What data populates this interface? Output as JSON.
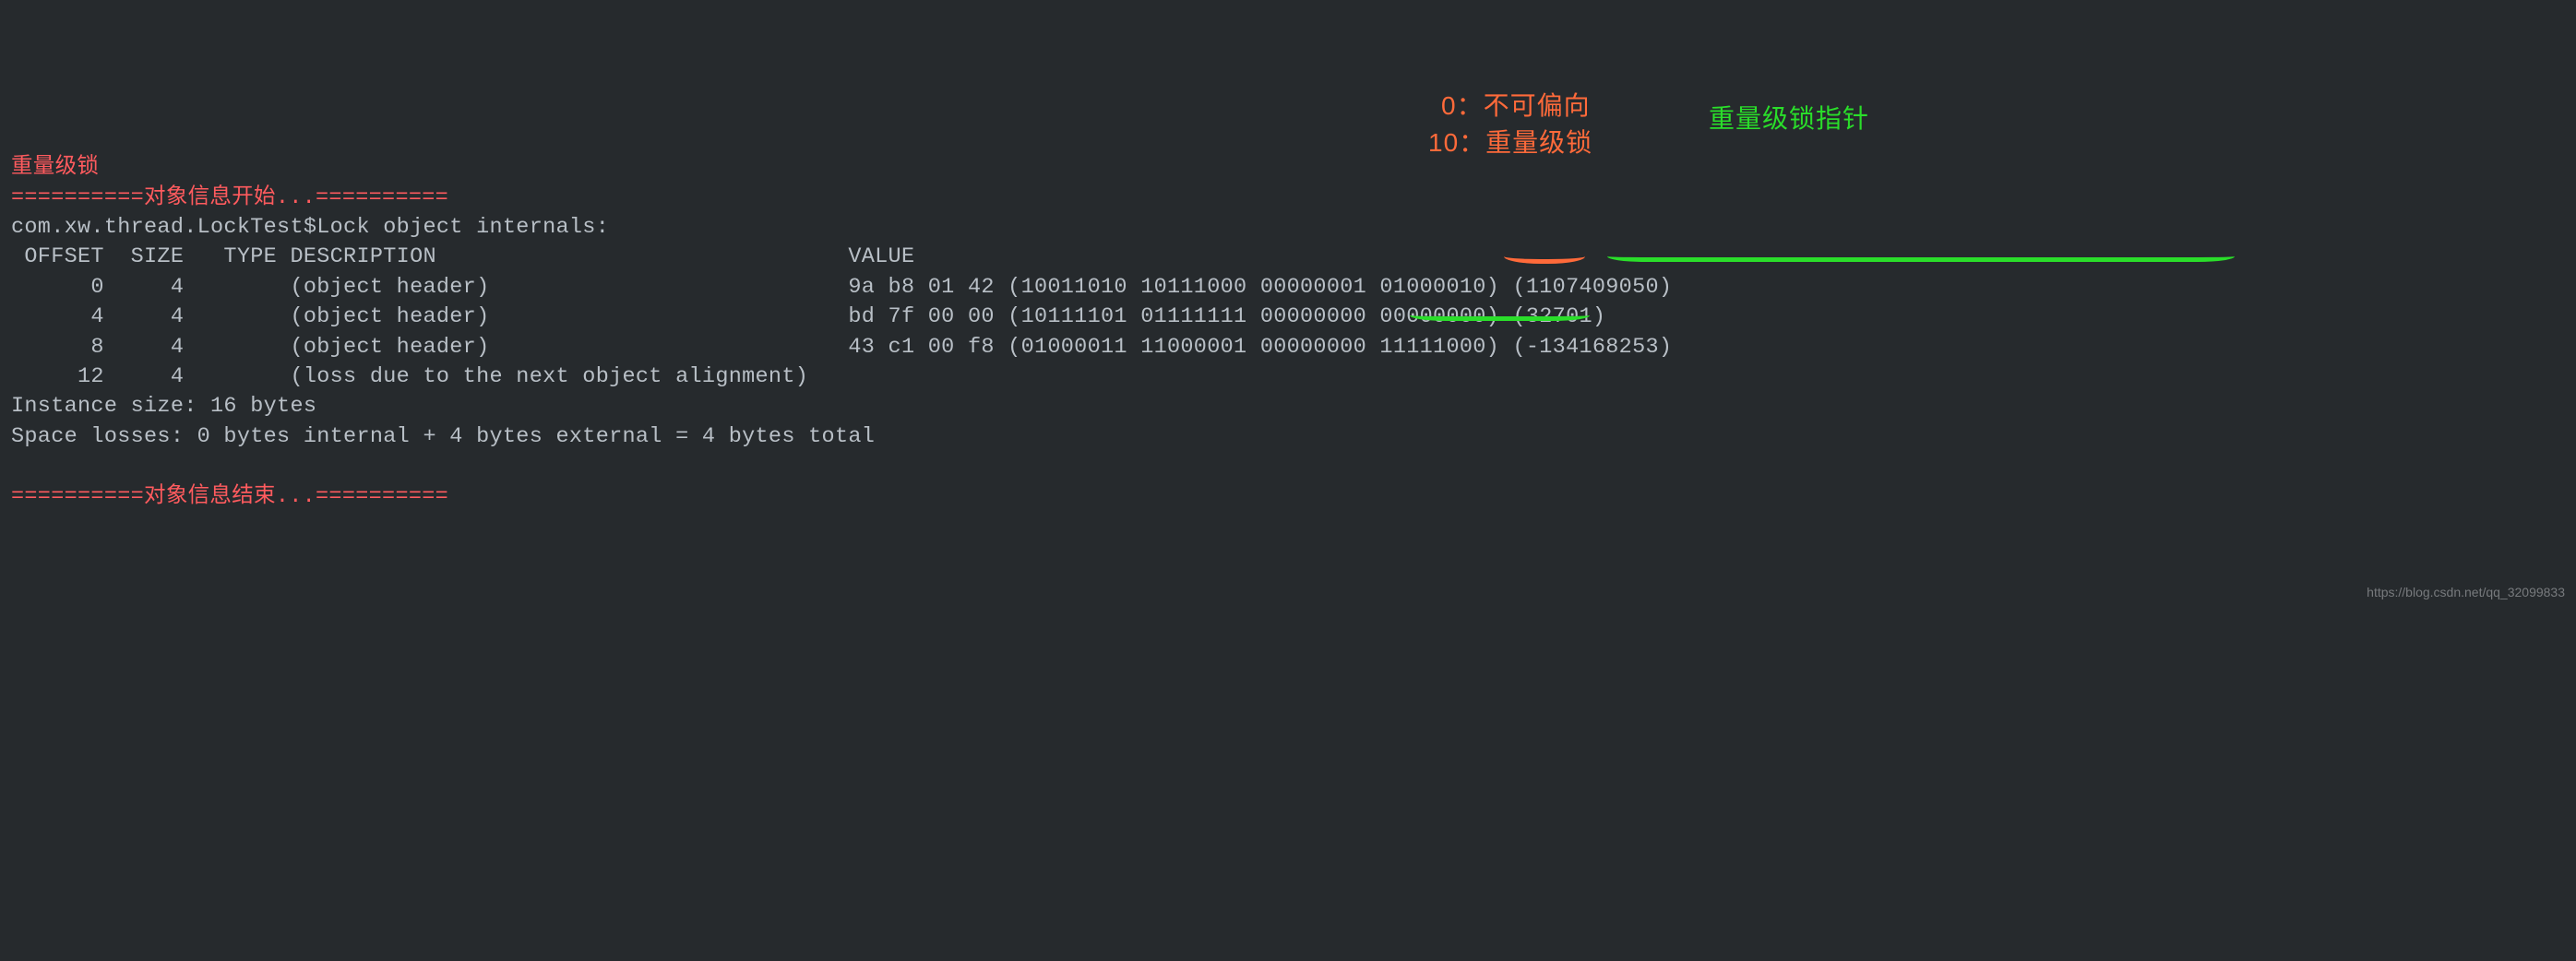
{
  "title": "重量级锁",
  "divider_start": "==========对象信息开始...==========",
  "class_line": "com.xw.thread.LockTest$Lock object internals:",
  "header_line": " OFFSET  SIZE   TYPE DESCRIPTION                               VALUE",
  "rows": [
    "      0     4        (object header)                           9a b8 01 42 (10011010 10111000 00000001 01000010) (1107409050)",
    "      4     4        (object header)                           bd 7f 00 00 (10111101 01111111 00000000 00000000) (32701)",
    "      8     4        (object header)                           43 c1 00 f8 (01000011 11000001 00000000 11111000) (-134168253)",
    "     12     4        (loss due to the next object alignment)"
  ],
  "instance_size": "Instance size: 16 bytes",
  "space_losses": "Space losses: 0 bytes internal + 4 bytes external = 4 bytes total",
  "divider_end": "==========对象信息结束...==========",
  "annotations": {
    "red1": "0：不可偏向",
    "red2": "10：重量级锁",
    "green": "重量级锁指针"
  },
  "watermark": "https://blog.csdn.net/qq_32099833"
}
